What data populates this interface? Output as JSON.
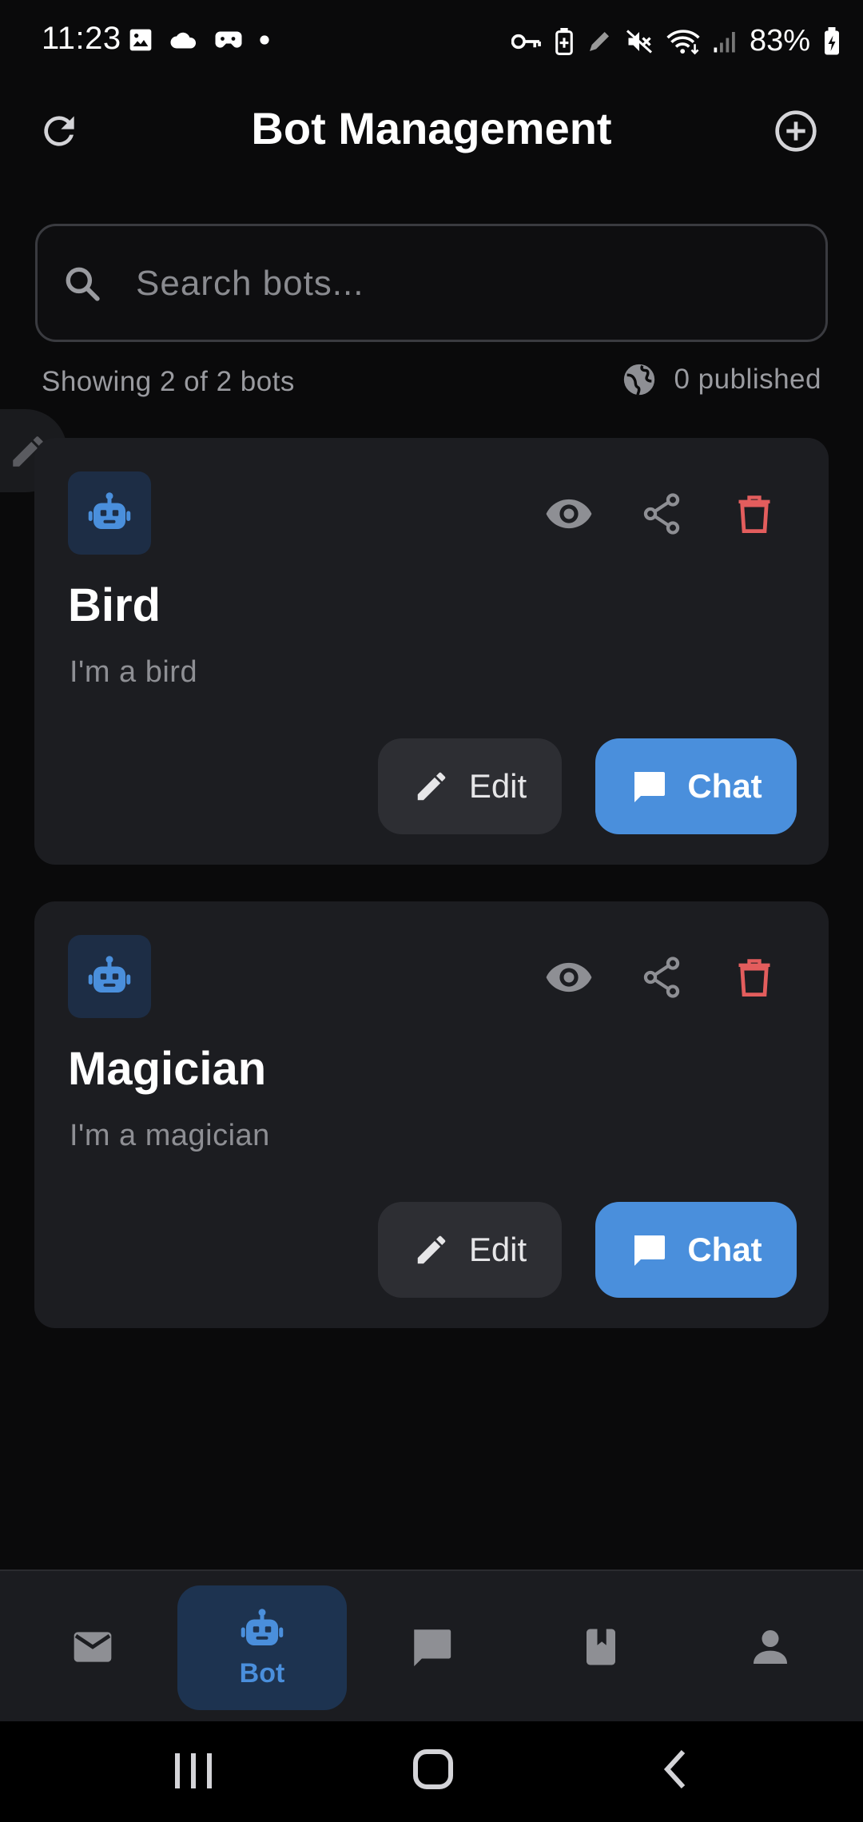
{
  "status_bar": {
    "time": "11:23",
    "battery": "83%",
    "left_icons": [
      "image-icon",
      "cloud-icon",
      "game-icon",
      "dot-icon"
    ],
    "right_icons": [
      "key-icon",
      "battery-saver-icon",
      "pen-icon",
      "mute-icon",
      "wifi-icon",
      "signal-icon",
      "battery-icon"
    ]
  },
  "header": {
    "title": "Bot Management",
    "left_icon": "refresh-icon",
    "right_icon": "add-circle-icon"
  },
  "search": {
    "placeholder": "Search bots..."
  },
  "summary": {
    "showing": "Showing 2 of 2 bots",
    "published": "0 published"
  },
  "bots": [
    {
      "name": "Bird",
      "description": "I'm a bird",
      "edit_label": "Edit",
      "chat_label": "Chat"
    },
    {
      "name": "Magician",
      "description": "I'm a magician",
      "edit_label": "Edit",
      "chat_label": "Chat"
    }
  ],
  "bottom_nav": {
    "items": [
      {
        "icon": "mail-icon"
      },
      {
        "icon": "bot-icon",
        "label": "Bot",
        "active": true
      },
      {
        "icon": "chat-icon"
      },
      {
        "icon": "book-icon"
      },
      {
        "icon": "person-icon"
      }
    ]
  },
  "colors": {
    "accent": "#4a8fdc",
    "danger": "#e35d5d",
    "card": "#1c1d21",
    "background": "#0a0a0b"
  }
}
